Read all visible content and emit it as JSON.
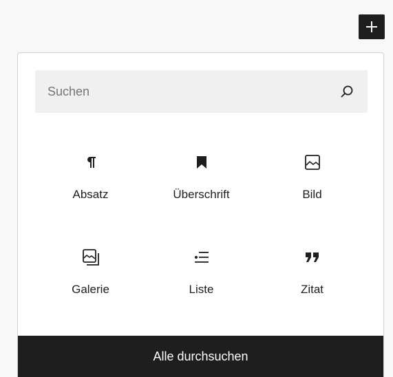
{
  "toolbar": {
    "inserter_icon": "plus-icon"
  },
  "search": {
    "placeholder": "Suchen",
    "value": "",
    "icon": "search-icon"
  },
  "blocks": [
    {
      "label": "Absatz",
      "icon": "paragraph-icon"
    },
    {
      "label": "Überschrift",
      "icon": "heading-bookmark-icon"
    },
    {
      "label": "Bild",
      "icon": "image-icon"
    },
    {
      "label": "Galerie",
      "icon": "gallery-icon"
    },
    {
      "label": "Liste",
      "icon": "list-icon"
    },
    {
      "label": "Zitat",
      "icon": "quote-icon"
    }
  ],
  "footer": {
    "browse_all_label": "Alle durchsuchen"
  },
  "colors": {
    "dark": "#1e1e1e",
    "search_bg": "#f0f0f0",
    "placeholder": "#757575"
  }
}
